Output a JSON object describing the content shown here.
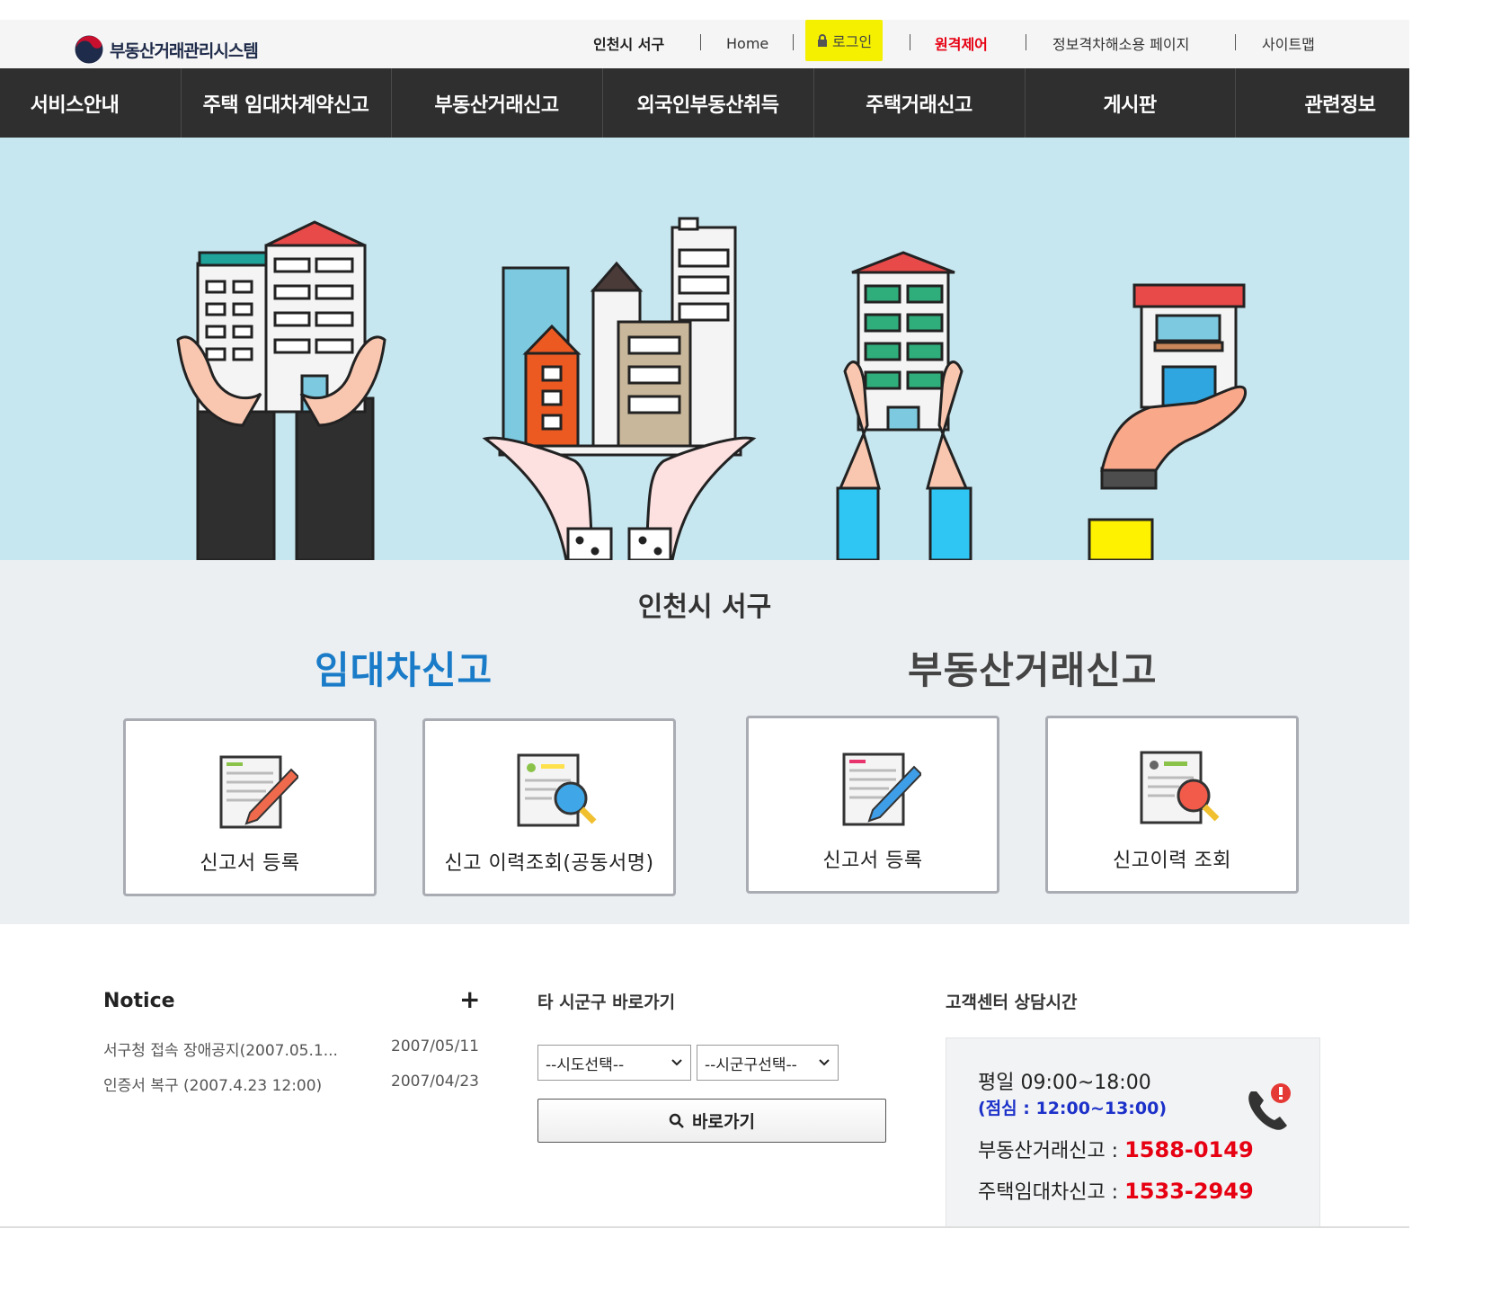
{
  "logo": {
    "text": "부동산거래관리시스템"
  },
  "util_nav": {
    "region": "인천시 서구",
    "home": "Home",
    "login": "로그인",
    "remote": "원격제어",
    "info_gap": "정보격차해소용 페이지",
    "sitemap": "사이트맵"
  },
  "gnb": [
    "서비스안내",
    "주택 임대차계약신고",
    "부동산거래신고",
    "외국인부동산취득",
    "주택거래신고",
    "게시판",
    "관련정보"
  ],
  "quick": {
    "region_title": "인천시 서구",
    "lease_title": "임대차신고",
    "trade_title": "부동산거래신고",
    "lease_title_color": "#1a7cc8",
    "trade_title_color": "#444444",
    "cards": [
      {
        "label": "신고서 등록",
        "icon": "document-pencil-icon"
      },
      {
        "label": "신고 이력조회(공동서명)",
        "icon": "document-search-icon"
      },
      {
        "label": "신고서 등록",
        "icon": "document-pencil-icon"
      },
      {
        "label": "신고이력 조회",
        "icon": "document-search-icon"
      }
    ]
  },
  "notice": {
    "title": "Notice",
    "more": "+",
    "items": [
      {
        "title": "서구청 접속 장애공지(2007.05.1...",
        "date": "2007/05/11"
      },
      {
        "title": "인증서 복구 (2007.4.23 12:00)",
        "date": "2007/04/23"
      }
    ]
  },
  "shortcut": {
    "title": "타 시군구 바로가기",
    "sido": "--시도선택--",
    "sigungu": "--시군구선택--",
    "button": "바로가기"
  },
  "cs": {
    "title": "고객센터 상담시간",
    "weekday": "평일 09:00~18:00",
    "lunch": "(점심 : 12:00~13:00)",
    "trade_label": "부동산거래신고 : ",
    "trade_number": "1588-0149",
    "lease_label": "주택임대차신고 : ",
    "lease_number": "1533-2949"
  }
}
